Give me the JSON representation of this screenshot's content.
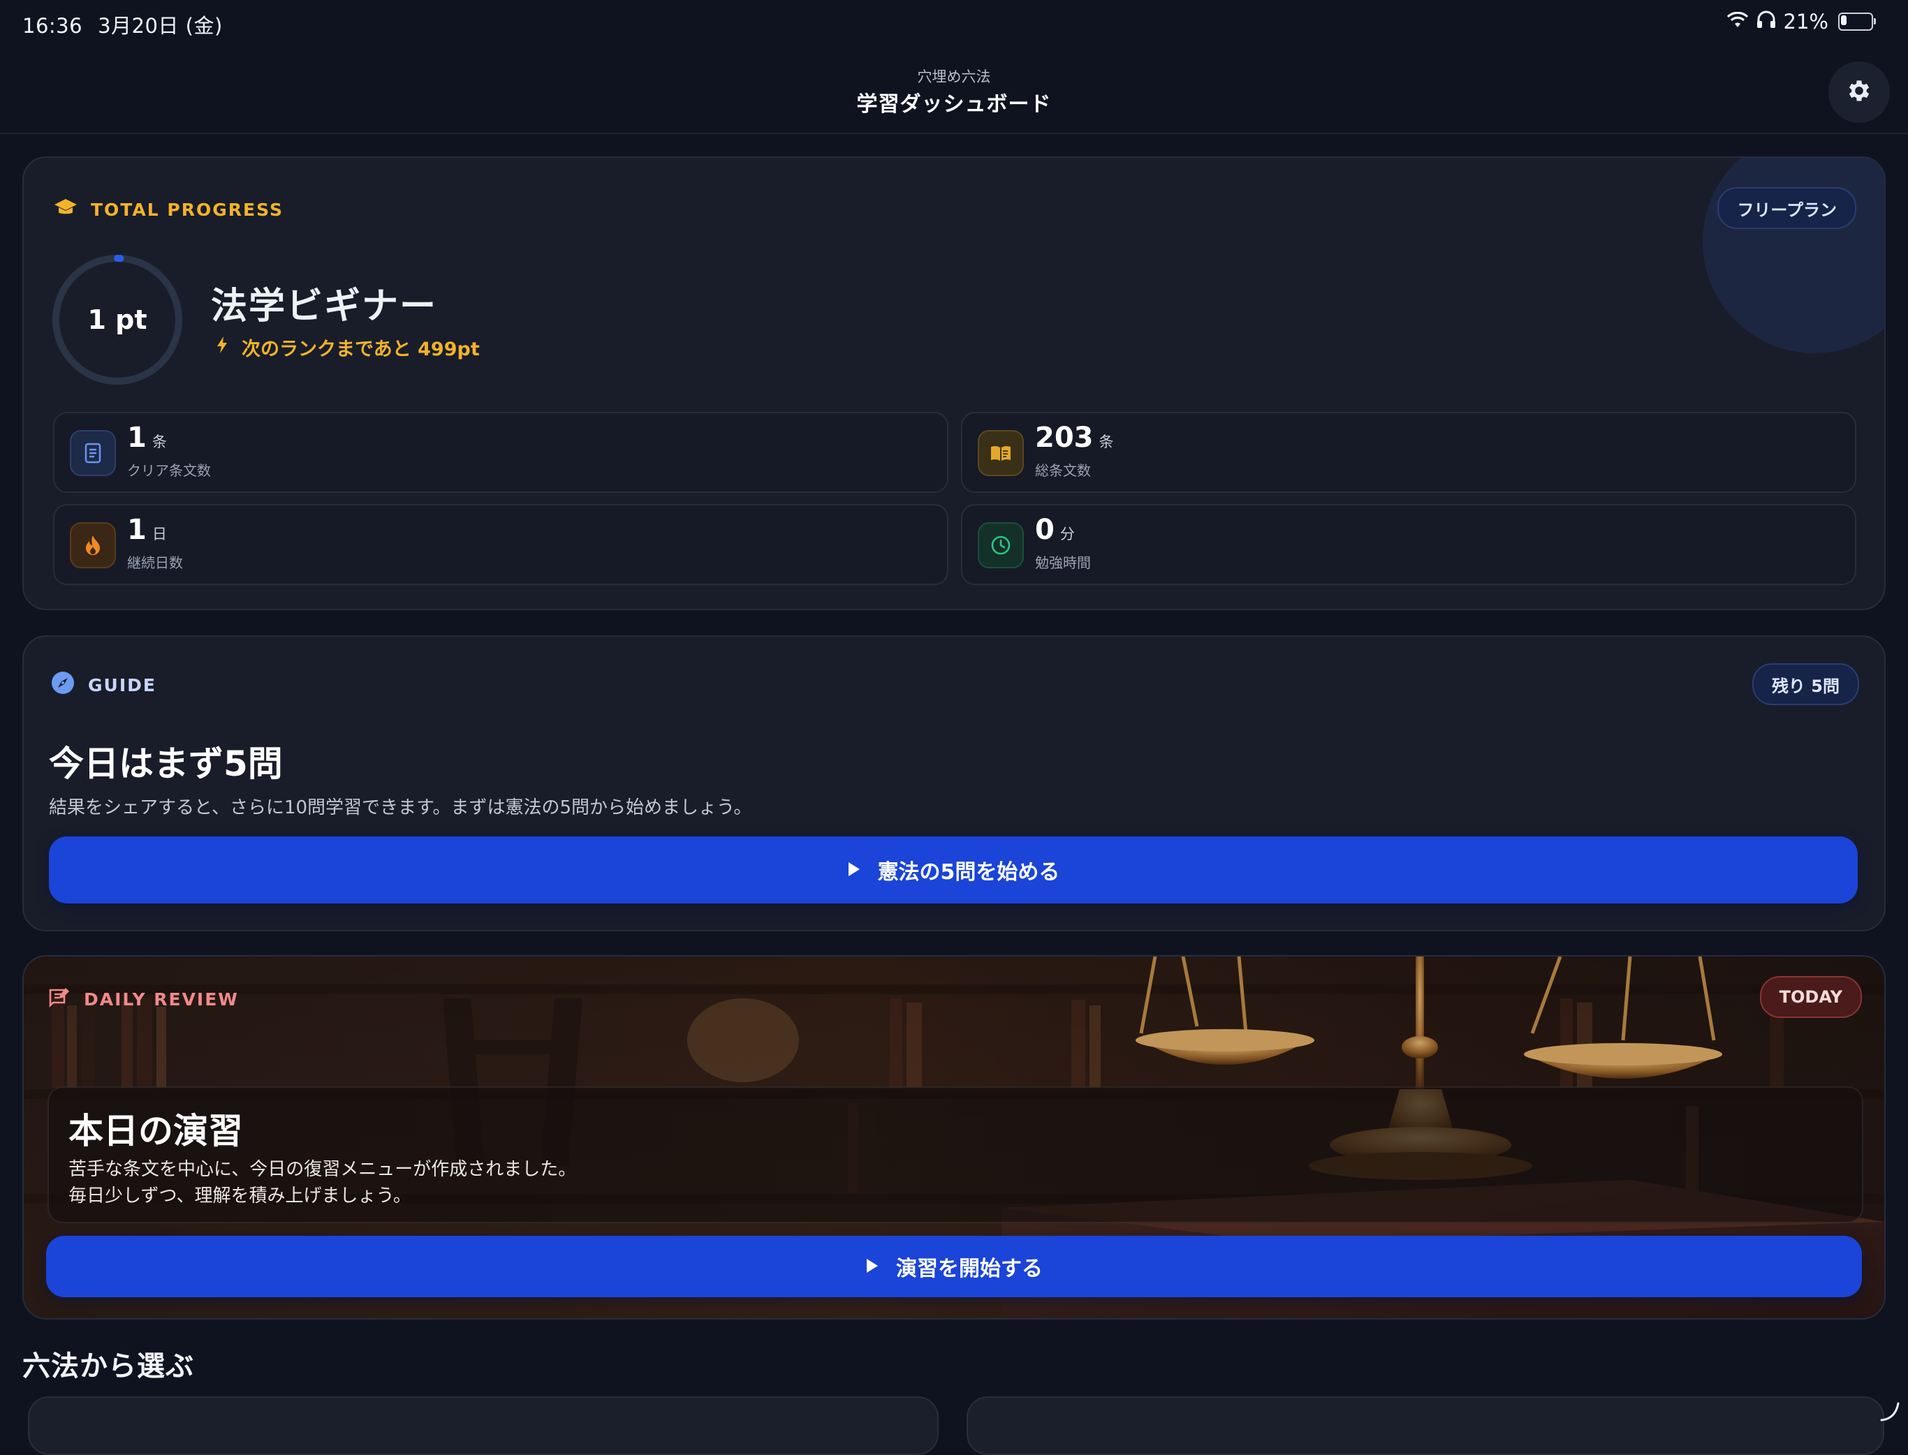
{
  "status_bar": {
    "time": "16:36",
    "date": "3月20日 (金)",
    "battery": "21%",
    "battery_level": 0.21,
    "icons": [
      "wifi-icon",
      "headphones-icon",
      "battery-icon"
    ]
  },
  "header": {
    "subtitle": "穴埋め六法",
    "title": "学習ダッシュボード",
    "settings_icon": "gear-icon"
  },
  "progress": {
    "section_label": "TOTAL PROGRESS",
    "plan_badge": "フリープラン",
    "points": "1 pt",
    "ring_progress": 0.002,
    "rank": "法学ビギナー",
    "next_rank": "次のランクまであと 499pt",
    "stats": [
      {
        "value": "1",
        "unit": "条",
        "label": "クリア条文数",
        "icon": "document-icon"
      },
      {
        "value": "203",
        "unit": "条",
        "label": "総条文数",
        "icon": "book-icon"
      },
      {
        "value": "1",
        "unit": "日",
        "label": "継続日数",
        "icon": "flame-icon"
      },
      {
        "value": "0",
        "unit": "分",
        "label": "勉強時間",
        "icon": "clock-icon"
      }
    ]
  },
  "guide": {
    "section_label": "GUIDE",
    "remaining_badge": "残り 5問",
    "title": "今日はまず5問",
    "description": "結果をシェアすると、さらに10問学習できます。まずは憲法の5問から始めましょう。",
    "cta": "憲法の5問を始める"
  },
  "daily_review": {
    "section_label": "DAILY REVIEW",
    "badge": "TODAY",
    "title": "本日の演習",
    "description_line1": "苦手な条文を中心に、今日の復習メニューが作成されました。",
    "description_line2": "毎日少しずつ、理解を積み上げましょう。",
    "cta": "演習を開始する"
  },
  "browse": {
    "title": "六法から選ぶ"
  },
  "colors": {
    "background": "#0f1320",
    "card": "#191d2a",
    "accent_blue": "#1b44d8",
    "gold": "#f2b32b",
    "daily_red": "#f08a8a"
  }
}
